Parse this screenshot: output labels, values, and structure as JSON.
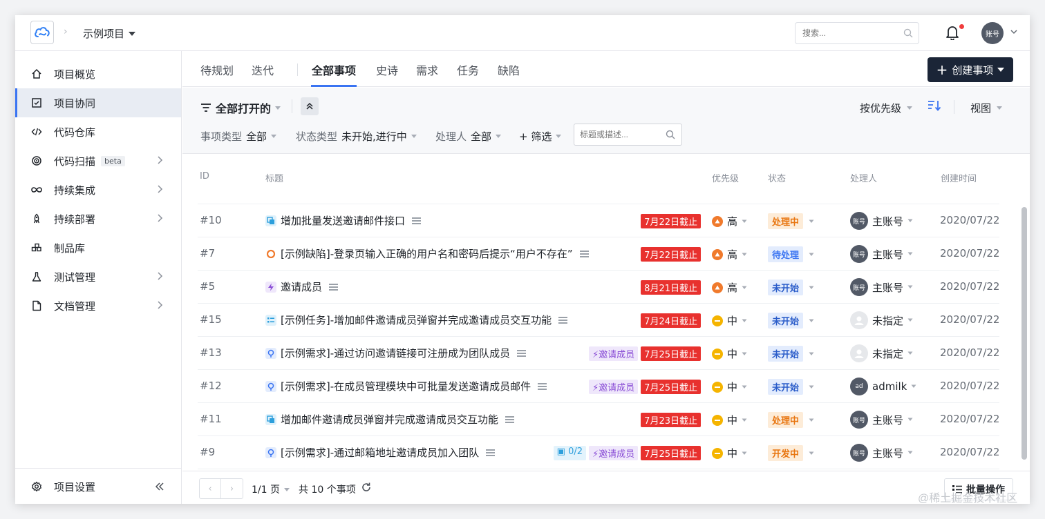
{
  "colors": {
    "accent": "#3a74f2",
    "primary_button": "#1b2537",
    "due_tag": "#e8312e"
  },
  "header": {
    "project_name": "示例项目",
    "search_placeholder": "搜索...",
    "account_label": "账号"
  },
  "sidebar": {
    "items": [
      {
        "label": "项目概览",
        "icon": "home-icon",
        "has_chevron": false,
        "active": false
      },
      {
        "label": "项目协同",
        "icon": "checkbox-icon",
        "has_chevron": false,
        "active": true
      },
      {
        "label": "代码仓库",
        "icon": "code-icon",
        "has_chevron": false,
        "active": false
      },
      {
        "label": "代码扫描",
        "icon": "target-icon",
        "badge": "beta",
        "has_chevron": true,
        "active": false
      },
      {
        "label": "持续集成",
        "icon": "infinity-icon",
        "has_chevron": true,
        "active": false
      },
      {
        "label": "持续部署",
        "icon": "rocket-icon",
        "has_chevron": true,
        "active": false
      },
      {
        "label": "制品库",
        "icon": "package-icon",
        "has_chevron": false,
        "active": false
      },
      {
        "label": "测试管理",
        "icon": "flask-icon",
        "has_chevron": true,
        "active": false
      },
      {
        "label": "文档管理",
        "icon": "document-icon",
        "has_chevron": true,
        "active": false
      }
    ],
    "settings_label": "项目设置"
  },
  "tabs": {
    "items": [
      "待规划",
      "迭代",
      "全部事项",
      "史诗",
      "需求",
      "任务",
      "缺陷"
    ],
    "active": "全部事项",
    "create_label": "创建事项"
  },
  "toolbar": {
    "filter_name": "全部打开的",
    "sort_label": "按优先级",
    "view_label": "视图",
    "filters": [
      {
        "key": "事项类型",
        "value": "全部"
      },
      {
        "key": "状态类型",
        "value": "未开始,进行中"
      },
      {
        "key": "处理人",
        "value": "全部"
      }
    ],
    "add_filter_label": "+ 筛选",
    "search_placeholder": "标题或描述..."
  },
  "table": {
    "columns": {
      "id": "ID",
      "title": "标题",
      "priority": "优先级",
      "status": "状态",
      "owner": "处理人",
      "created": "创建时间"
    },
    "rows": [
      {
        "id": "#10",
        "type": "task",
        "title": "增加批量发送邀请邮件接口",
        "subtasks": "",
        "epic": "",
        "due": "7月22日截止",
        "priority": "高",
        "status": "处理中",
        "owner": "主账号",
        "avatar": "账号",
        "created": "2020/07/22"
      },
      {
        "id": "#7",
        "type": "bug",
        "title": "[示例缺陷]-登录页输入正确的用户名和密码后提示“用户不存在”",
        "subtasks": "",
        "epic": "",
        "due": "7月22日截止",
        "priority": "高",
        "status": "待处理",
        "owner": "主账号",
        "avatar": "账号",
        "created": "2020/07/22"
      },
      {
        "id": "#5",
        "type": "epic",
        "title": "邀请成员",
        "subtasks": "",
        "epic": "",
        "due": "8月21日截止",
        "priority": "高",
        "status": "未开始",
        "owner": "主账号",
        "avatar": "账号",
        "created": "2020/07/22"
      },
      {
        "id": "#15",
        "type": "subtask",
        "title": "[示例任务]-增加邮件邀请成员弹窗并完成邀请成员交互功能",
        "subtasks": "",
        "epic": "",
        "due": "7月24日截止",
        "priority": "中",
        "status": "未开始",
        "owner": "未指定",
        "avatar": "",
        "created": "2020/07/22"
      },
      {
        "id": "#13",
        "type": "story",
        "title": "[示例需求]-通过访问邀请链接可注册成为团队成员",
        "subtasks": "",
        "epic": "邀请成员",
        "due": "7月25日截止",
        "priority": "中",
        "status": "未开始",
        "owner": "未指定",
        "avatar": "",
        "created": "2020/07/22"
      },
      {
        "id": "#12",
        "type": "story",
        "title": "[示例需求]-在成员管理模块中可批量发送邀请成员邮件",
        "subtasks": "",
        "epic": "邀请成员",
        "due": "7月25日截止",
        "priority": "中",
        "status": "未开始",
        "owner": "admilk",
        "avatar": "ad",
        "created": "2020/07/22"
      },
      {
        "id": "#11",
        "type": "task",
        "title": "增加邮件邀请成员弹窗并完成邀请成员交互功能",
        "subtasks": "",
        "epic": "",
        "due": "7月23日截止",
        "priority": "中",
        "status": "处理中",
        "owner": "主账号",
        "avatar": "账号",
        "created": "2020/07/22"
      },
      {
        "id": "#9",
        "type": "story",
        "title": "[示例需求]-通过邮箱地址邀请成员加入团队",
        "subtasks": "0/2",
        "epic": "邀请成员",
        "due": "7月25日截止",
        "priority": "中",
        "status": "开发中",
        "owner": "主账号",
        "avatar": "账号",
        "created": "2020/07/22"
      }
    ]
  },
  "footer": {
    "page_label": "1/1 页",
    "count_label": "共 10 个事项",
    "batch_label": "批量操作"
  },
  "watermark": "@稀土掘金技术社区"
}
